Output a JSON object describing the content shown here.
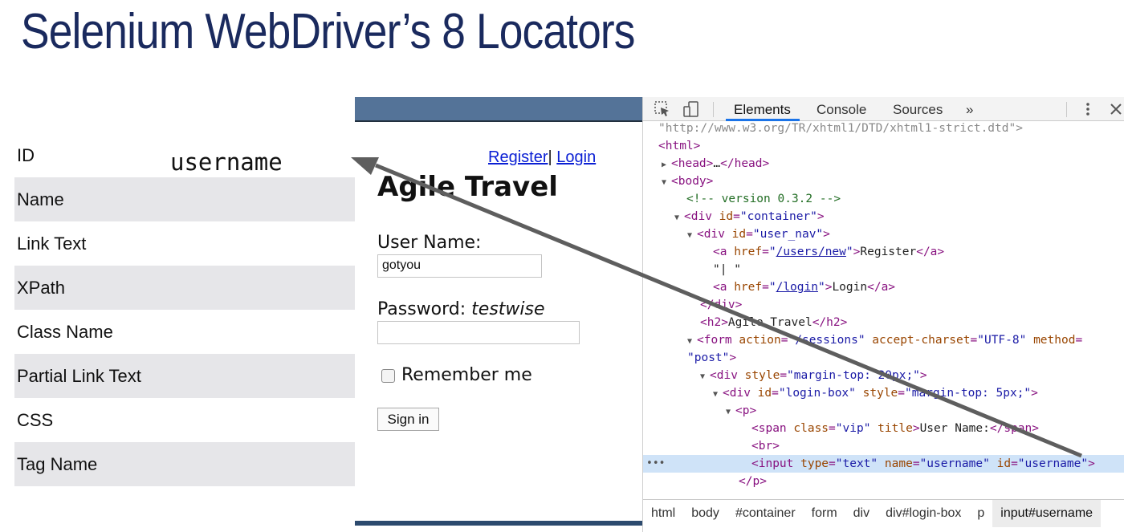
{
  "slide": {
    "title": "Selenium WebDriver’s 8 Locators"
  },
  "locators": {
    "items": [
      "ID",
      "Name",
      "Link Text",
      "XPath",
      "Class Name",
      "Partial Link Text",
      "CSS",
      "Tag Name"
    ],
    "id_value": "username"
  },
  "browser": {
    "nav": {
      "register": "Register",
      "separator": "|",
      "login": "Login"
    },
    "heading": "Agile Travel",
    "username_label": "User Name:",
    "username_value": "gotyou",
    "password_label": "Password: ",
    "password_hint": "testwise",
    "remember_label": "Remember me",
    "signin_label": "Sign in"
  },
  "devtools": {
    "tabs": [
      "Elements",
      "Console",
      "Sources"
    ],
    "more_tabs": "»",
    "breadcrumbs": [
      "html",
      "body",
      "#container",
      "form",
      "div",
      "div#login-box",
      "p",
      "input#username"
    ],
    "code": {
      "doctype_line": "\"http://www.w3.org/TR/xhtml1/DTD/xhtml1-strict.dtd\">",
      "comment": "<!-- version 0.3.2 -->",
      "register_href": "/users/new",
      "register_text": "Register",
      "sep_text": "\"| \"",
      "login_href": "/login",
      "login_text": "Login",
      "h2_text": "Agile Travel",
      "form_action": "\"/sessions\"",
      "form_charset": "\"UTF-8\"",
      "form_method": "\"post\"",
      "div_style": "\"margin-top: 20px;\"",
      "loginbox_id": "\"login-box\"",
      "loginbox_style": "\"margin-top: 5px;\"",
      "span_class": "\"vip\"",
      "span_text": "User Name:",
      "input_type": "\"text\"",
      "input_name": "\"username\"",
      "input_id": "\"username\""
    }
  },
  "colors": {
    "title": "#1a2a5e",
    "browser_header": "#547398",
    "row_alt": "#e6e6e9",
    "selected_node": "#cfe3f8",
    "arrow": "#5e5e5e"
  }
}
